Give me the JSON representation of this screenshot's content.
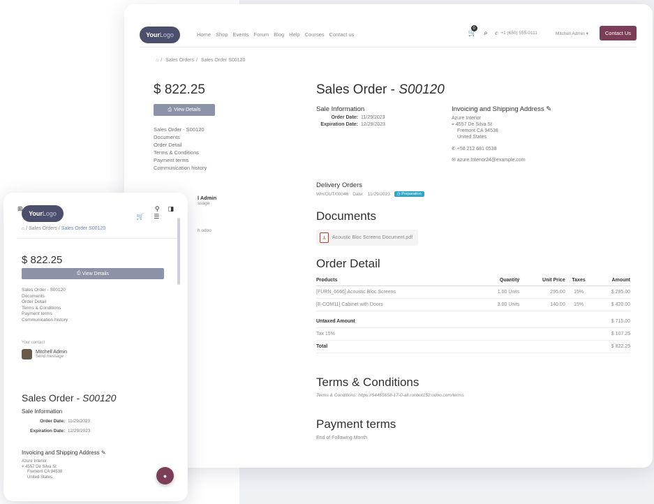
{
  "desktop": {
    "logo": {
      "a": "Your",
      "b": "Logo"
    },
    "nav_links": [
      "Home",
      "Shop",
      "Events",
      "Forum",
      "Blog",
      "Help",
      "Courses",
      "Contact us"
    ],
    "cart_count": "0",
    "phone": "+1 (650) 555-0111",
    "user_menu": "Mitchell Admin",
    "contact_button": "Contact Us",
    "breadcrumb": {
      "home_icon": "home-icon",
      "items": [
        "Sales Orders",
        "Sales Order S00120"
      ]
    },
    "sidebar": {
      "amount": "$ 822.25",
      "view_details": "View Details",
      "toc": [
        "Sales Order - S00120",
        "Documents",
        "Order Detail",
        "Terms & Conditions",
        "Payment terms",
        "Communication history"
      ],
      "contact_name_partial": "l Admin",
      "contact_msg_partial": "ssage",
      "powered_partial": "h odoo"
    },
    "main": {
      "title_prefix": "Sales Order - ",
      "title_ref": "S00120",
      "sale_info_heading": "Sale Information",
      "order_date_label": "Order Date:",
      "order_date": "11/29/2023",
      "expiration_label": "Expiration Date:",
      "expiration_date": "12/29/2023",
      "address_heading": "Invoicing and Shipping Address",
      "address": [
        "Azure Interior",
        "4557 De Silva St",
        "Fremont CA 94538",
        "United States"
      ],
      "phone": "+58 212 681 0538",
      "email": "azure.Interior24@example.com",
      "delivery_heading": "Delivery Orders",
      "delivery_ref": "WH/OUT/00046",
      "delivery_date_label": "Date:",
      "delivery_date": "11/29/2023",
      "delivery_status": "Preparation",
      "documents_heading": "Documents",
      "document_name": "Acoustic Bloc Screens Document.pdf",
      "order_detail_heading": "Order Detail",
      "table_headers": [
        "Products",
        "Quantity",
        "Unit Price",
        "Taxes",
        "Amount"
      ],
      "rows": [
        {
          "product": "[FURN_6666] Acoustic Bloc Screens",
          "qty": "1.00 Units",
          "price": "295.00",
          "tax": "15%",
          "amount": "$ 295.00"
        },
        {
          "product": "[E-COM11] Cabinet with Doors",
          "qty": "3.00 Units",
          "price": "140.00",
          "tax": "15%",
          "amount": "$ 420.00"
        }
      ],
      "untaxed_label": "Untaxed Amount",
      "untaxed_value": "$ 715.00",
      "tax_label": "Tax 15%",
      "tax_value": "$ 107.25",
      "total_label": "Total",
      "total_value": "$ 822.25",
      "terms_heading": "Terms & Conditions",
      "terms_text": "Terms & Conditions: https://54455658-17-0-all.runbot152.odoo.com/terms",
      "payment_heading": "Payment terms",
      "payment_text": "End of Following Month"
    }
  },
  "mobile": {
    "logo": {
      "a": "Your",
      "b": "Logo"
    },
    "breadcrumb": [
      "Sales Orders",
      "Sales Order S00120"
    ],
    "amount": "$ 822.25",
    "view_details": "View Details",
    "toc": [
      "Sales Order - S00120",
      "Documents",
      "Order Detail",
      "Terms & Conditions",
      "Payment terms",
      "Communication history"
    ],
    "contact_heading": "Your contact",
    "contact_name": "Mitchell Admin",
    "contact_msg": "Send message",
    "title_prefix": "Sales Order - ",
    "title_ref": "S00120",
    "sale_info_heading": "Sale Information",
    "order_date_label": "Order Date:",
    "order_date": "11/29/2023",
    "expiration_label": "Expiration Date:",
    "expiration_date": "12/29/2023",
    "address_heading": "Invoicing and Shipping Address",
    "address": [
      "Azure Interior",
      "4557 De Silva St",
      "Fremont CA 94538",
      "United States"
    ]
  },
  "colors": {
    "accent": "#7b3d57",
    "button_grey": "#8c93a8",
    "badge_blue": "#31a6c7",
    "logo_bg": "#4b4f6b"
  }
}
